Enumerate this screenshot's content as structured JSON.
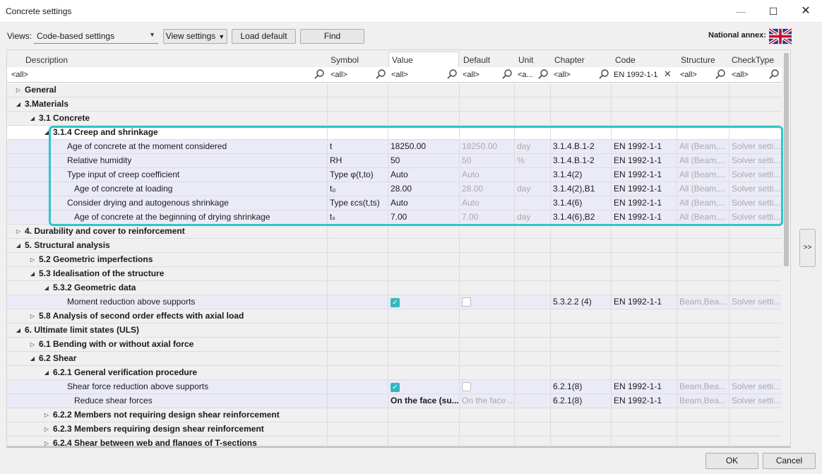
{
  "window": {
    "title": "Concrete settings",
    "minimize_glyph": "—",
    "maximize_glyph": "☐",
    "close_glyph": "✕"
  },
  "toolbar": {
    "views_label": "Views:",
    "views_value": "Code-based settings",
    "view_settings_label": "View settings",
    "load_default_label": "Load default",
    "find_label": "Find",
    "national_annex_label": "National annex:",
    "national_annex_flag": "uk-flag-icon"
  },
  "columns": {
    "description": "Description",
    "symbol": "Symbol",
    "value": "Value",
    "default": "Default",
    "unit": "Unit",
    "chapter": "Chapter",
    "code": "Code",
    "structure": "Structure",
    "checktype": "CheckType"
  },
  "filters": {
    "description": "<all>",
    "symbol": "<all>",
    "value": "<all>",
    "default": "<all>",
    "unit": "<a...",
    "chapter": "<all>",
    "code": "EN 1992-1-1",
    "structure": "<all>",
    "checktype": "<all>"
  },
  "rows": [
    {
      "style": "gray",
      "level": 0,
      "toggle": "▷",
      "bold": true,
      "desc": "General",
      "sym": "",
      "val": "",
      "def": "",
      "unit": "",
      "chap": "",
      "code": "",
      "struct": "",
      "ct": ""
    },
    {
      "style": "gray",
      "level": 0,
      "toggle": "◢",
      "bold": true,
      "desc": "3.Materials",
      "sym": "",
      "val": "",
      "def": "",
      "unit": "",
      "chap": "",
      "code": "",
      "struct": "",
      "ct": ""
    },
    {
      "style": "gray",
      "level": 1,
      "toggle": "◢",
      "bold": true,
      "desc": "3.1 Concrete",
      "sym": "",
      "val": "",
      "def": "",
      "unit": "",
      "chap": "",
      "code": "",
      "struct": "",
      "ct": ""
    },
    {
      "style": "white",
      "level": 2,
      "toggle": "◢",
      "bold": true,
      "desc": "3.1.4 Creep and shrinkage",
      "sym": "",
      "val": "",
      "def": "",
      "unit": "",
      "chap": "",
      "code": "",
      "struct": "",
      "ct": ""
    },
    {
      "style": "lav",
      "level": 3,
      "toggle": "",
      "bold": false,
      "desc": "Age of concrete at the moment considered",
      "sym": "t",
      "val": "18250.00",
      "def": "18250.00",
      "unit": "day",
      "chap": "3.1.4.B.1-2",
      "code": "EN 1992-1-1",
      "struct": "All (Beam,...",
      "ct": "Solver setti..."
    },
    {
      "style": "lav",
      "level": 3,
      "toggle": "",
      "bold": false,
      "desc": "Relative humidity",
      "sym": "RH",
      "val": "50",
      "def": "50",
      "unit": "%",
      "chap": "3.1.4.B.1-2",
      "code": "EN 1992-1-1",
      "struct": "All (Beam,...",
      "ct": "Solver setti..."
    },
    {
      "style": "lav",
      "level": 3,
      "toggle": "",
      "bold": false,
      "desc": "Type input of creep coefficient",
      "sym": "Type φ(t,to)",
      "val": "Auto",
      "def": "Auto",
      "unit": "",
      "chap": "3.1.4(2)",
      "code": "EN 1992-1-1",
      "struct": "All (Beam,...",
      "ct": "Solver setti..."
    },
    {
      "style": "lav",
      "level": 4,
      "toggle": "",
      "bold": false,
      "desc": "Age of concrete at loading",
      "sym": "t₀",
      "val": "28.00",
      "def": "28.00",
      "unit": "day",
      "chap": "3.1.4(2),B1",
      "code": "EN 1992-1-1",
      "struct": "All (Beam,...",
      "ct": "Solver setti..."
    },
    {
      "style": "lav",
      "level": 3,
      "toggle": "",
      "bold": false,
      "desc": "Consider drying and autogenous shrinkage",
      "sym": "Type εcs(t,ts)",
      "val": "Auto",
      "def": "Auto",
      "unit": "",
      "chap": "3.1.4(6)",
      "code": "EN 1992-1-1",
      "struct": "All (Beam,...",
      "ct": "Solver setti..."
    },
    {
      "style": "lav",
      "level": 4,
      "toggle": "",
      "bold": false,
      "desc": "Age of concrete at the beginning of drying shrinkage",
      "sym": "tₛ",
      "val": "7.00",
      "def": "7.00",
      "unit": "day",
      "chap": "3.1.4(6),B2",
      "code": "EN 1992-1-1",
      "struct": "All (Beam,...",
      "ct": "Solver setti..."
    },
    {
      "style": "gray",
      "level": 0,
      "toggle": "▷",
      "bold": true,
      "desc": "4. Durability and cover to reinforcement",
      "sym": "",
      "val": "",
      "def": "",
      "unit": "",
      "chap": "",
      "code": "",
      "struct": "",
      "ct": ""
    },
    {
      "style": "gray",
      "level": 0,
      "toggle": "◢",
      "bold": true,
      "desc": "5. Structural analysis",
      "sym": "",
      "val": "",
      "def": "",
      "unit": "",
      "chap": "",
      "code": "",
      "struct": "",
      "ct": ""
    },
    {
      "style": "gray",
      "level": 1,
      "toggle": "▷",
      "bold": true,
      "desc": "5.2 Geometric imperfections",
      "sym": "",
      "val": "",
      "def": "",
      "unit": "",
      "chap": "",
      "code": "",
      "struct": "",
      "ct": ""
    },
    {
      "style": "gray",
      "level": 1,
      "toggle": "◢",
      "bold": true,
      "desc": "5.3 Idealisation of the structure",
      "sym": "",
      "val": "",
      "def": "",
      "unit": "",
      "chap": "",
      "code": "",
      "struct": "",
      "ct": ""
    },
    {
      "style": "gray",
      "level": 2,
      "toggle": "◢",
      "bold": true,
      "desc": "5.3.2 Geometric data",
      "sym": "",
      "val": "",
      "def": "",
      "unit": "",
      "chap": "",
      "code": "",
      "struct": "",
      "ct": ""
    },
    {
      "style": "lav",
      "level": 3,
      "toggle": "",
      "bold": false,
      "desc": "Moment reduction above supports",
      "sym": "",
      "val": "check-on",
      "def": "check-off",
      "unit": "",
      "chap": "5.3.2.2 (4)",
      "code": "EN 1992-1-1",
      "struct": "Beam,Bea...",
      "ct": "Solver setti..."
    },
    {
      "style": "gray",
      "level": 1,
      "toggle": "▷",
      "bold": true,
      "desc": "5.8 Analysis of second order effects with axial load",
      "sym": "",
      "val": "",
      "def": "",
      "unit": "",
      "chap": "",
      "code": "",
      "struct": "",
      "ct": ""
    },
    {
      "style": "gray",
      "level": 0,
      "toggle": "◢",
      "bold": true,
      "desc": "6. Ultimate limit states (ULS)",
      "sym": "",
      "val": "",
      "def": "",
      "unit": "",
      "chap": "",
      "code": "",
      "struct": "",
      "ct": ""
    },
    {
      "style": "gray",
      "level": 1,
      "toggle": "▷",
      "bold": true,
      "desc": "6.1 Bending with or without axial force",
      "sym": "",
      "val": "",
      "def": "",
      "unit": "",
      "chap": "",
      "code": "",
      "struct": "",
      "ct": ""
    },
    {
      "style": "gray",
      "level": 1,
      "toggle": "◢",
      "bold": true,
      "desc": "6.2 Shear",
      "sym": "",
      "val": "",
      "def": "",
      "unit": "",
      "chap": "",
      "code": "",
      "struct": "",
      "ct": ""
    },
    {
      "style": "gray",
      "level": 2,
      "toggle": "◢",
      "bold": true,
      "desc": "6.2.1 General verification procedure",
      "sym": "",
      "val": "",
      "def": "",
      "unit": "",
      "chap": "",
      "code": "",
      "struct": "",
      "ct": ""
    },
    {
      "style": "lav",
      "level": 3,
      "toggle": "",
      "bold": false,
      "desc": "Shear force reduction above supports",
      "sym": "",
      "val": "check-on",
      "def": "check-off",
      "unit": "",
      "chap": "6.2.1(8)",
      "code": "EN 1992-1-1",
      "struct": "Beam,Bea...",
      "ct": "Solver setti..."
    },
    {
      "style": "lav",
      "level": 4,
      "toggle": "",
      "bold": false,
      "desc": "Reduce shear forces",
      "sym": "",
      "val": "On the face (su...",
      "def": "On the face ...",
      "unit": "",
      "chap": "6.2.1(8)",
      "code": "EN 1992-1-1",
      "struct": "Beam,Bea...",
      "ct": "Solver setti...",
      "valbold": true
    },
    {
      "style": "gray",
      "level": 2,
      "toggle": "▷",
      "bold": true,
      "desc": "6.2.2 Members not requiring design shear reinforcement",
      "sym": "",
      "val": "",
      "def": "",
      "unit": "",
      "chap": "",
      "code": "",
      "struct": "",
      "ct": ""
    },
    {
      "style": "gray",
      "level": 2,
      "toggle": "▷",
      "bold": true,
      "desc": "6.2.3 Members requiring design shear reinforcement",
      "sym": "",
      "val": "",
      "def": "",
      "unit": "",
      "chap": "",
      "code": "",
      "struct": "",
      "ct": ""
    },
    {
      "style": "gray",
      "level": 2,
      "toggle": "▷",
      "bold": true,
      "desc": "6.2.4 Shear between web and flanges of T-sections",
      "sym": "",
      "val": "",
      "def": "",
      "unit": "",
      "chap": "",
      "code": "",
      "struct": "",
      "ct": ""
    }
  ],
  "side_button_label": ">>",
  "footer": {
    "ok_label": "OK",
    "cancel_label": "Cancel"
  }
}
